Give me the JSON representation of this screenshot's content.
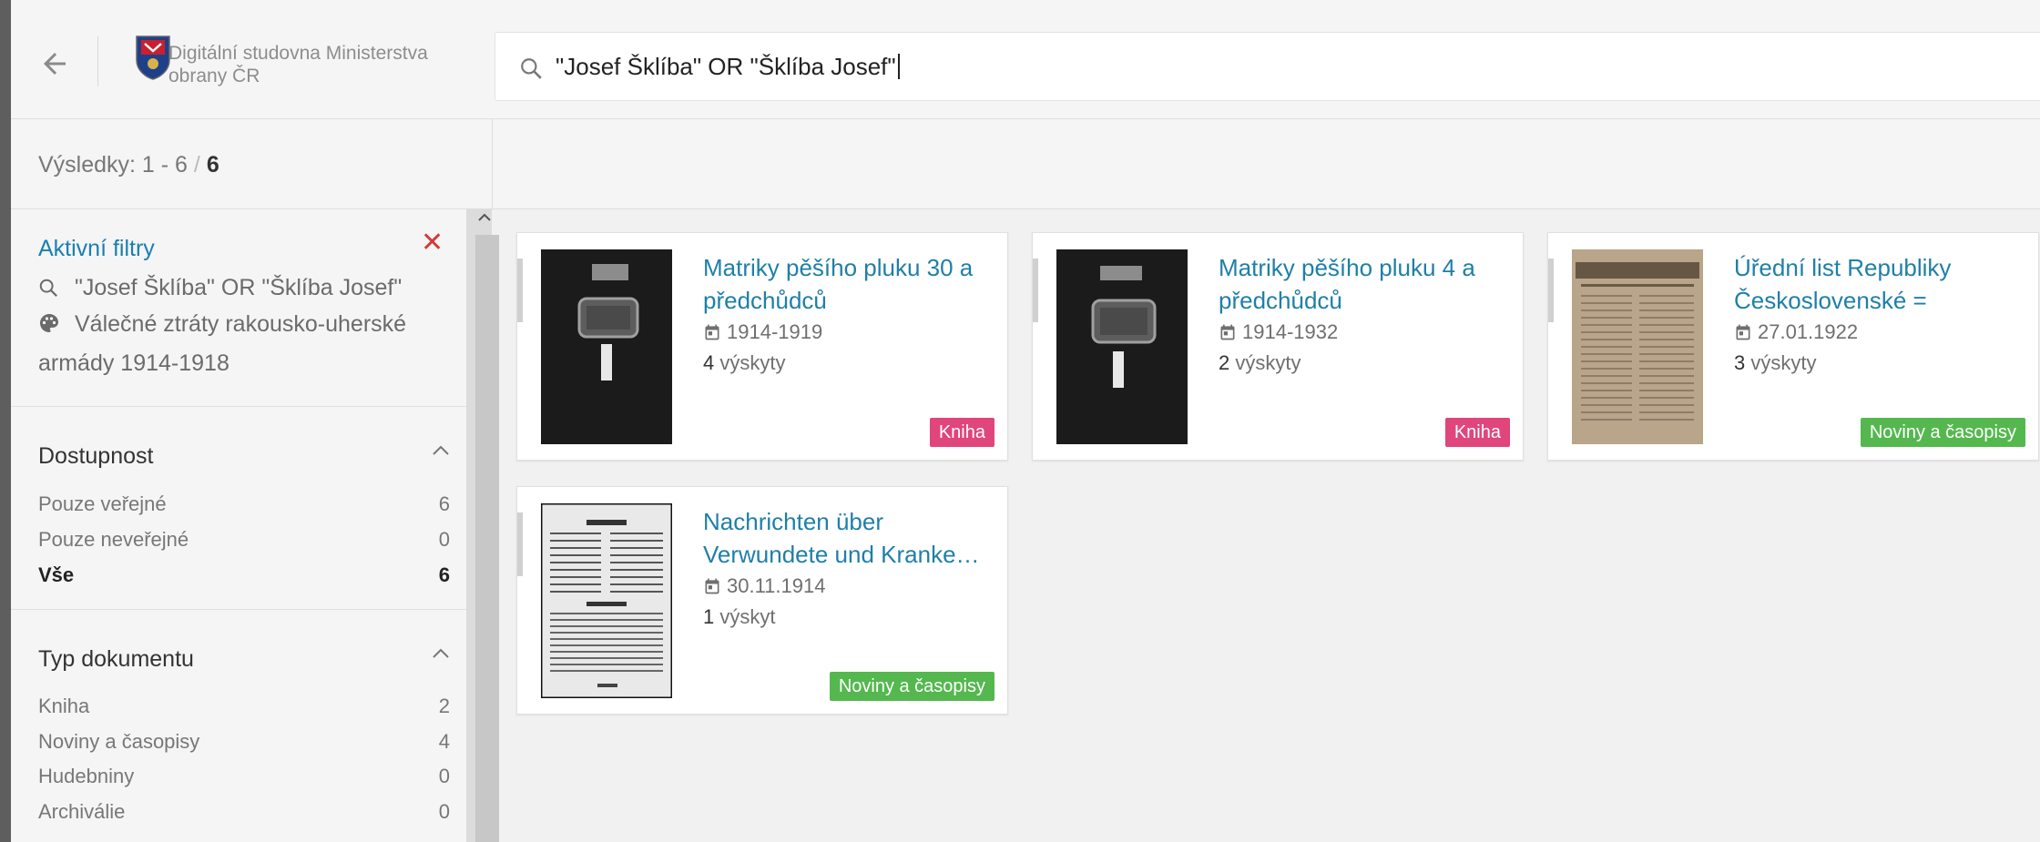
{
  "header": {
    "app_title": "Digitální studovna Ministerstva obrany ČR",
    "search_query": "\"Josef Šklíba\" OR \"Šklíba Josef\"",
    "back_icon": "arrow-left-icon",
    "search_icon": "search-icon"
  },
  "results": {
    "label": "Výsledky: 1 - 6",
    "separator": "/",
    "total": "6"
  },
  "sidebar": {
    "active_filters": {
      "title": "Aktivní filtry",
      "clear_icon": "close-icon",
      "items": [
        {
          "icon": "search-icon",
          "text": "\"Josef Šklíba\" OR \"Šklíba Josef\""
        },
        {
          "icon": "palette-icon",
          "text": "Válečné ztráty rakousko-uherské armády 1914-1918"
        }
      ]
    },
    "facets": [
      {
        "title": "Dostupnost",
        "toggle_icon": "chevron-up-icon",
        "rows": [
          {
            "label": "Pouze veřejné",
            "count": "6",
            "selected": false
          },
          {
            "label": "Pouze neveřejné",
            "count": "0",
            "selected": false
          },
          {
            "label": "Vše",
            "count": "6",
            "selected": true
          }
        ]
      },
      {
        "title": "Typ dokumentu",
        "toggle_icon": "chevron-up-icon",
        "rows": [
          {
            "label": "Kniha",
            "count": "2",
            "selected": false
          },
          {
            "label": "Noviny a časopisy",
            "count": "4",
            "selected": false
          },
          {
            "label": "Hudebniny",
            "count": "0",
            "selected": false
          },
          {
            "label": "Archiválie",
            "count": "0",
            "selected": false
          }
        ]
      }
    ]
  },
  "cards": [
    {
      "title": "Matriky pěšího pluku 30 a předchůdců",
      "date": "1914-1919",
      "occurrences_count": "4",
      "occurrences_word": "výskyty",
      "badge": "Kniha",
      "badge_type": "kniha"
    },
    {
      "title": "Matriky pěšího pluku 4 a předchůdců",
      "date": "1914-1932",
      "occurrences_count": "2",
      "occurrences_word": "výskyty",
      "badge": "Kniha",
      "badge_type": "kniha"
    },
    {
      "title": "Úřední list Republiky Československé =",
      "date": "27.01.1922",
      "occurrences_count": "3",
      "occurrences_word": "výskyty",
      "badge": "Noviny a časopisy",
      "badge_type": "noviny"
    },
    {
      "title": "Nachrichten über Verwundete und Kranke…",
      "date": "30.11.1914",
      "occurrences_count": "1",
      "occurrences_word": "výskyt",
      "badge": "Noviny a časopisy",
      "badge_type": "noviny"
    }
  ],
  "colors": {
    "link": "#1f7fa8",
    "kniha_badge": "#e0457b",
    "noviny_badge": "#54b84f",
    "clear_red": "#d43a3a"
  }
}
